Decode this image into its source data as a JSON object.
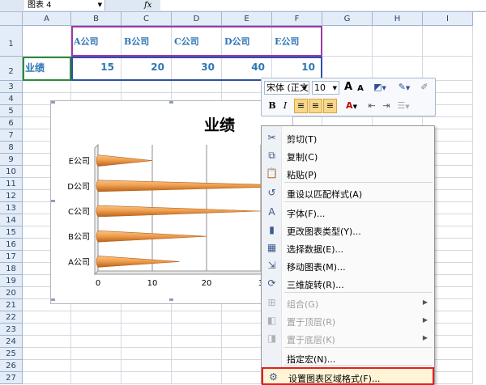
{
  "formula_bar": {
    "name_box": "图表 4",
    "fx": "fx"
  },
  "columns": [
    "A",
    "B",
    "C",
    "D",
    "E",
    "F",
    "G",
    "H",
    "I"
  ],
  "rows": [
    "1",
    "2",
    "3",
    "4",
    "5",
    "6",
    "7",
    "8",
    "9",
    "10",
    "11",
    "12",
    "13",
    "14",
    "15",
    "16",
    "17",
    "18",
    "19",
    "20",
    "21",
    "22",
    "23",
    "24",
    "25",
    "26",
    "27"
  ],
  "sheet": {
    "companies": [
      "A公司",
      "B公司",
      "C公司",
      "D公司",
      "E公司"
    ],
    "row_label": "业绩",
    "values": [
      "15",
      "20",
      "30",
      "40",
      "10"
    ]
  },
  "chart_data": {
    "type": "bar",
    "orientation": "horizontal",
    "title": "业绩",
    "categories": [
      "A公司",
      "B公司",
      "C公司",
      "D公司",
      "E公司"
    ],
    "values": [
      15,
      20,
      30,
      40,
      10
    ],
    "x_ticks": [
      "0",
      "10",
      "20",
      "3"
    ],
    "xlim": [
      0,
      30
    ],
    "grid": true,
    "bar_color": "#f0a050"
  },
  "mini_toolbar": {
    "font_name": "宋体 (正文",
    "font_size": "10",
    "bold": "B",
    "italic": "I",
    "font_color_icon": "A",
    "grow_font": "A",
    "shrink_font": "A"
  },
  "context_menu": {
    "items": [
      {
        "label": "剪切(T)",
        "icon": "scissors-icon",
        "disabled": false,
        "submenu": false
      },
      {
        "label": "复制(C)",
        "icon": "copy-icon",
        "disabled": false,
        "submenu": false
      },
      {
        "label": "粘贴(P)",
        "icon": "paste-icon",
        "disabled": false,
        "submenu": false
      },
      {
        "label": "重设以匹配样式(A)",
        "icon": "reset-style-icon",
        "disabled": false,
        "submenu": false
      },
      {
        "label": "字体(F)...",
        "icon": "font-icon",
        "disabled": false,
        "submenu": false
      },
      {
        "label": "更改图表类型(Y)...",
        "icon": "chart-type-icon",
        "disabled": false,
        "submenu": false
      },
      {
        "label": "选择数据(E)...",
        "icon": "select-data-icon",
        "disabled": false,
        "submenu": false
      },
      {
        "label": "移动图表(M)...",
        "icon": "move-chart-icon",
        "disabled": false,
        "submenu": false
      },
      {
        "label": "三维旋转(R)...",
        "icon": "rotate-3d-icon",
        "disabled": false,
        "submenu": false
      },
      {
        "label": "组合(G)",
        "icon": "group-icon",
        "disabled": true,
        "submenu": true
      },
      {
        "label": "置于顶层(R)",
        "icon": "bring-front-icon",
        "disabled": true,
        "submenu": true
      },
      {
        "label": "置于底层(K)",
        "icon": "send-back-icon",
        "disabled": true,
        "submenu": true
      },
      {
        "label": "指定宏(N)...",
        "icon": "macro-icon",
        "disabled": false,
        "submenu": false
      },
      {
        "label": "设置图表区域格式(F)...",
        "icon": "format-chart-area-icon",
        "disabled": false,
        "submenu": false,
        "highlighted": true
      }
    ]
  },
  "colors": {
    "highlight_box": "#e02020",
    "range_blue": "#2f4fa8",
    "range_purple": "#9a3aa8",
    "range_green": "#2f8a3a"
  }
}
